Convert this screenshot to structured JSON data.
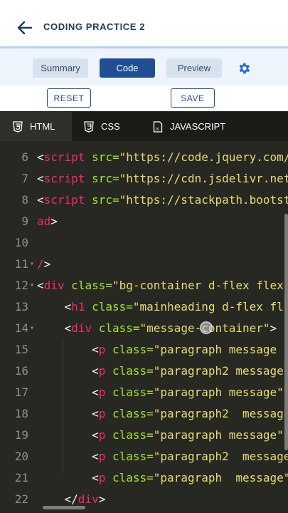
{
  "header": {
    "title": "CODING PRACTICE 2",
    "back_icon": "arrow-left-icon"
  },
  "view_tabs": [
    {
      "label": "Summary",
      "active": false
    },
    {
      "label": "Code",
      "active": true
    },
    {
      "label": "Preview",
      "active": false
    }
  ],
  "settings_icon": "gear-icon",
  "actions": {
    "reset_label": "RESET",
    "save_label": "SAVE"
  },
  "file_tabs": [
    {
      "label": "HTML",
      "icon": "html5-icon",
      "active": true
    },
    {
      "label": "CSS",
      "icon": "css3-icon",
      "active": false
    },
    {
      "label": "JAVASCRIPT",
      "icon": "js-file-icon",
      "active": false
    }
  ],
  "colors": {
    "accent": "#1f4f92",
    "editor_bg": "#272822",
    "tag": "#f92672",
    "attr": "#a6e22e",
    "string": "#e6db74"
  },
  "editor": {
    "lines": [
      {
        "n": "6",
        "pre": "<",
        "tag": "script",
        "attr": " src=",
        "str": "\"https://code.jquery.com/",
        "rest": ""
      },
      {
        "n": "7",
        "pre": "<",
        "tag": "script",
        "attr": " src=",
        "str": "\"https://cdn.jsdelivr.net",
        "rest": ""
      },
      {
        "n": "8",
        "pre": "<",
        "tag": "script",
        "attr": " src=",
        "str": "\"https://stackpath.bootst",
        "rest": ""
      },
      {
        "n": "9",
        "pre": "",
        "tag": "ad",
        "attr": "",
        "str": "",
        "rest": ">"
      },
      {
        "n": "10",
        "pre": "",
        "tag": "",
        "attr": "",
        "str": "",
        "rest": ""
      },
      {
        "n": "11",
        "pre": "",
        "tag": "/",
        "attr": "",
        "str": "",
        "rest": ">"
      },
      {
        "n": "12",
        "pre": "<",
        "tag": "div",
        "attr": " class=",
        "str": "\"bg-container d-flex flex",
        "rest": ""
      },
      {
        "n": "13",
        "pre": "    <",
        "tag": "h1",
        "attr": " class=",
        "str": "\"mainheading d-flex fl",
        "rest": ""
      },
      {
        "n": "14",
        "pre": "    <",
        "tag": "div",
        "attr": " class=",
        "str": "\"message-container\"",
        "rest": ">"
      },
      {
        "n": "15",
        "pre": "        <",
        "tag": "p",
        "attr": " class=",
        "str": "\"paragraph message ",
        "rest": ""
      },
      {
        "n": "16",
        "pre": "        <",
        "tag": "p",
        "attr": " class=",
        "str": "\"paragraph2 message",
        "rest": ""
      },
      {
        "n": "17",
        "pre": "        <",
        "tag": "p",
        "attr": " class=",
        "str": "\"paragraph message\"",
        "rest": ""
      },
      {
        "n": "18",
        "pre": "        <",
        "tag": "p",
        "attr": " class=",
        "str": "\"paragraph2  message",
        "rest": ""
      },
      {
        "n": "19",
        "pre": "        <",
        "tag": "p",
        "attr": " class=",
        "str": "\"paragraph message\"",
        "rest": ""
      },
      {
        "n": "20",
        "pre": "        <",
        "tag": "p",
        "attr": " class=",
        "str": "\"paragraph2  message",
        "rest": ""
      },
      {
        "n": "21",
        "pre": "        <",
        "tag": "p",
        "attr": " class=",
        "str": "\"paragraph  message\"",
        "rest": ""
      },
      {
        "n": "22",
        "pre": "    </",
        "tag": "div",
        "attr": "",
        "str": "",
        "rest": ">"
      }
    ]
  }
}
